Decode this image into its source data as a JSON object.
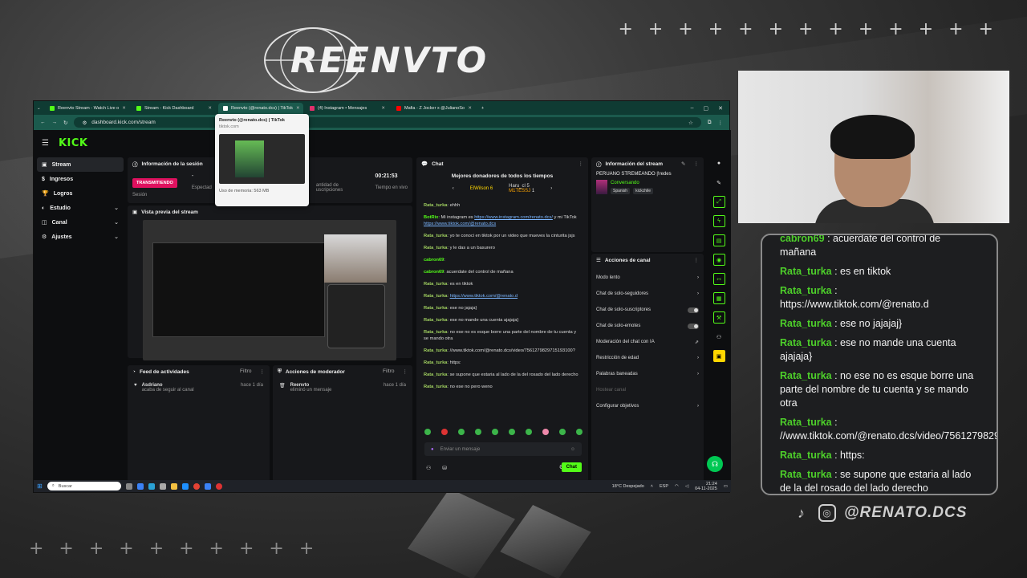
{
  "overlay": {
    "logo_text": "REENVTO",
    "plus_top": "+ + + + + + + + + + + + +",
    "plus_bottom": "+ + + + + + + + + +",
    "handle": "@RENATO.DCS"
  },
  "browser": {
    "tabs": [
      {
        "label": "Reenvto Stream - Watch Live o",
        "color": "#53fc18"
      },
      {
        "label": "Stream - Kick Dashboard",
        "color": "#53fc18"
      },
      {
        "label": "Reenvto (@renato.dcs) | TikTok",
        "color": "#ffffff"
      },
      {
        "label": "(4) Instagram • Mensajes",
        "color": "#e1306c"
      },
      {
        "label": "Mafia - Z Jocker x @JulianoSo",
        "color": "#ff0000"
      }
    ],
    "url": "dashboard.kick.com/stream",
    "tooltip": {
      "title": "Reenvto (@renato.dcs) | TikTok",
      "domain": "tiktok.com",
      "memory": "Uso de memoria: 563 MB"
    }
  },
  "kick": {
    "brand": "KICK",
    "sidebar": [
      {
        "label": "Stream",
        "selected": true
      },
      {
        "label": "Ingresos"
      },
      {
        "label": "Logros"
      },
      {
        "label": "Estudio",
        "chev": "⌄"
      },
      {
        "label": "Canal",
        "chev": "⌄"
      },
      {
        "label": "Ajustes",
        "chev": "⌄"
      }
    ],
    "session": {
      "title": "Información de la sesión",
      "live_badge": "TRANSMITIENDO",
      "label_session": "Sesión",
      "dash": "-",
      "label_viewers": "Espectad",
      "label_subs_1": "antidad de",
      "label_subs_2": "uscripciones",
      "time": "00:21:53",
      "label_time": "Tiempo en vivo"
    },
    "preview": {
      "title": "Vista previa del stream"
    },
    "feed": {
      "title": "Feed de actividades",
      "filter": "Filtro",
      "user": "Asdriano",
      "action": "acaba de seguir al canal",
      "time": "hace 1 día"
    },
    "mod": {
      "title": "Acciones de moderador",
      "filter": "Filtro",
      "user": "Reenvto",
      "action": "eliminó un mensaje",
      "time": "hace 1 día"
    },
    "chat": {
      "title": "Chat",
      "donors_title": "Mejores donadores de todos los tiempos",
      "donors": [
        {
          "name": "ElWilson",
          "amount": "6"
        },
        {
          "name": "Haru_cl",
          "amount": "5"
        },
        {
          "name": "M1TESSJ",
          "amount": "1"
        }
      ],
      "messages": [
        {
          "user": "Rata_turka",
          "text": "ehhh"
        },
        {
          "user": "BotRix",
          "text": "Mi instagram es",
          "link": "https://www.instagram.com/renato.dcs/",
          "text2": " y mi TikTok",
          "link2": "https://www.tiktok.com/@renato.dcs"
        },
        {
          "user": "Rata_turka",
          "text": "yo te conoci en tiktok por un video que mueves la cinturita jsjs"
        },
        {
          "user": "Rata_turka",
          "text": "y le das a un basurero"
        },
        {
          "user": "cabron69",
          "text": ""
        },
        {
          "user": "cabron69",
          "text": "acuerdate del control de mañana"
        },
        {
          "user": "Rata_turka",
          "text": "es en tiktok"
        },
        {
          "user": "Rata_turka",
          "link": "https://www.tiktok.com/@renato.d"
        },
        {
          "user": "Rata_turka",
          "text": "ese no jajaja}"
        },
        {
          "user": "Rata_turka",
          "text": "ese no mande una cuenta ajajaja}"
        },
        {
          "user": "Rata_turka",
          "text": "no ese no es esque borre una parte del nombre de tu cuenta y se mando otra"
        },
        {
          "user": "Rata_turka",
          "text": "//www.tiktok.com/@renato.dcs/video/7561279829715193100?"
        },
        {
          "user": "Rata_turka",
          "text": "https:"
        },
        {
          "user": "Rata_turka",
          "text": "se supone que estaria al lado de la del rosado del lado derecho"
        },
        {
          "user": "Rata_turka",
          "text": "no ese no pero weno"
        }
      ],
      "input_placeholder": "Enviar un mensaje",
      "send": "Chat"
    },
    "stream_info": {
      "title": "Información del stream",
      "stream_title": "PERUANO STREMEANDO |!redes",
      "category": "Conversando",
      "tags": [
        "Spanish",
        "kickchile"
      ]
    },
    "channel_actions": {
      "title": "Acciones de canal",
      "items": [
        {
          "label": "Modo lento",
          "kind": "chev"
        },
        {
          "label": "Chat de solo-seguidores",
          "kind": "chev"
        },
        {
          "label": "Chat de solo-suscriptores",
          "kind": "toggle"
        },
        {
          "label": "Chat de solo-emotes",
          "kind": "toggle"
        },
        {
          "label": "Moderación del chat con IA",
          "kind": "ext"
        },
        {
          "label": "Restricción de edad",
          "kind": "chev"
        },
        {
          "label": "Palabras baneadas",
          "kind": "chev"
        },
        {
          "label": "Hostear canal",
          "kind": "none",
          "disabled": true
        },
        {
          "label": "Configurar objetivos",
          "kind": "chev"
        }
      ]
    }
  },
  "taskbar": {
    "search": "Buscar",
    "weather": "18°C Despejado",
    "lang": "ESP",
    "time": "21:24",
    "date": "04-11-2025"
  },
  "overlay_chat": [
    {
      "user": "cabron69",
      "text": "acuerdate del control de mañana"
    },
    {
      "user": "Rata_turka",
      "text": "es en tiktok"
    },
    {
      "user": "Rata_turka",
      "text": "https://www.tiktok.com/@renato.d"
    },
    {
      "user": "Rata_turka",
      "text": "ese no jajajaj}"
    },
    {
      "user": "Rata_turka",
      "text": "ese no mande una cuenta ajajaja}"
    },
    {
      "user": "Rata_turka",
      "text": "no ese no es esque borre una parte del nombre de tu cuenta y se mando otra"
    },
    {
      "user": "Rata_turka",
      "text": "//www.tiktok.com/@renato.dcs/video/7561279829715193100?"
    },
    {
      "user": "Rata_turka",
      "text": "https:"
    },
    {
      "user": "Rata_turka",
      "text": "se supone que estaria al lado de la del rosado del lado derecho"
    },
    {
      "user": "",
      "text": "no ese no pero weno"
    }
  ]
}
